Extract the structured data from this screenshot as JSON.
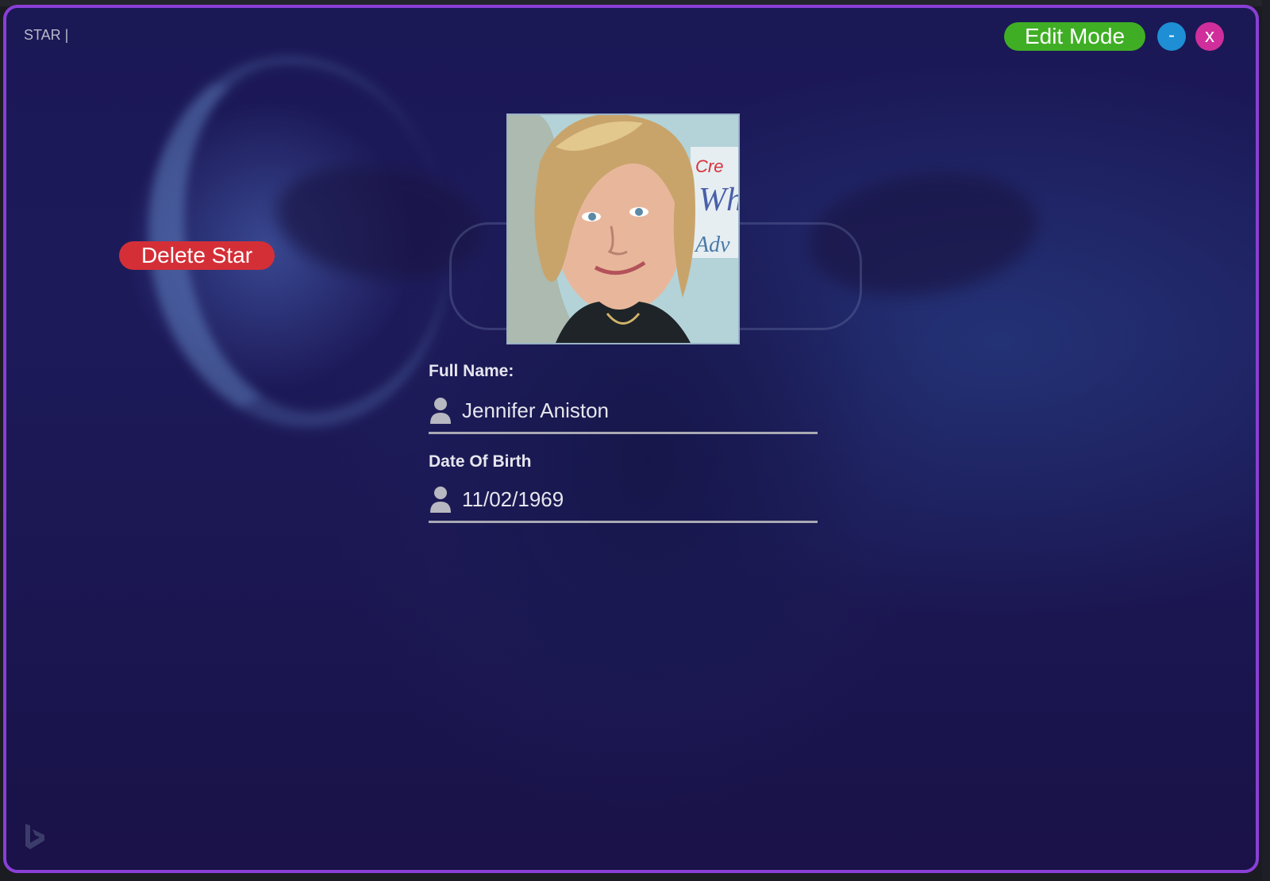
{
  "window": {
    "title": "STAR |"
  },
  "toolbar": {
    "edit_label": "Edit Mode",
    "minimize_label": "-",
    "close_label": "x"
  },
  "actions": {
    "delete_label": "Delete Star"
  },
  "form": {
    "full_name_label": "Full Name:",
    "full_name_value": "Jennifer Aniston",
    "dob_label": "Date Of Birth",
    "dob_value": "11/02/1969"
  },
  "colors": {
    "border": "#8a3fd6",
    "edit_button": "#3fae24",
    "minimize_button": "#1e8fd4",
    "close_button": "#d02f9b",
    "delete_button": "#d42f37",
    "background": "#1b1856"
  },
  "icons": {
    "field_icon": "user-icon",
    "watermark": "bing-logo-icon"
  }
}
